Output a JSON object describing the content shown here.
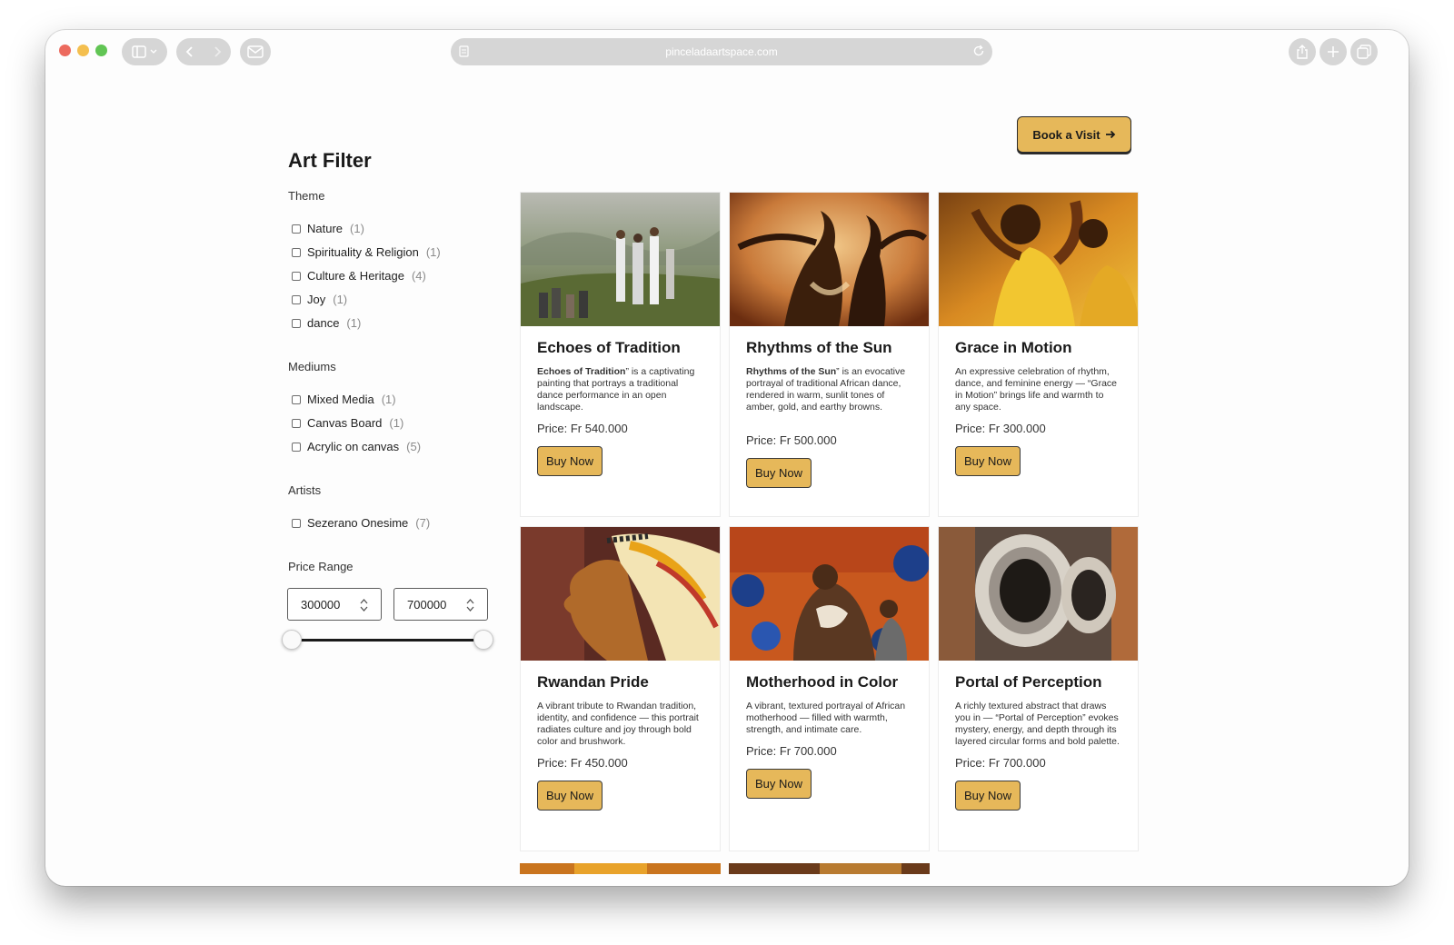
{
  "browser": {
    "url": "pinceladaartspace.com"
  },
  "header": {
    "book_label": "Book a Visit"
  },
  "filter": {
    "title": "Art Filter",
    "theme": {
      "label": "Theme",
      "items": [
        {
          "label": "Nature",
          "count": "(1)"
        },
        {
          "label": "Spirituality & Religion",
          "count": "(1)"
        },
        {
          "label": "Culture & Heritage",
          "count": "(4)"
        },
        {
          "label": "Joy",
          "count": "(1)"
        },
        {
          "label": "dance",
          "count": "(1)"
        }
      ]
    },
    "mediums": {
      "label": "Mediums",
      "items": [
        {
          "label": "Mixed Media",
          "count": "(1)"
        },
        {
          "label": "Canvas Board",
          "count": "(1)"
        },
        {
          "label": "Acrylic on canvas",
          "count": "(5)"
        }
      ]
    },
    "artists": {
      "label": "Artists",
      "items": [
        {
          "label": "Sezerano Onesime",
          "count": "(7)"
        }
      ]
    },
    "price": {
      "label": "Price Range",
      "min": "300000",
      "max": "700000"
    }
  },
  "artworks": [
    {
      "title": "Echoes of Tradition",
      "desc_bold": "Echoes of Tradition",
      "desc": "” is a captivating painting that portrays a traditional dance performance in an open landscape.",
      "price": "Price: Fr 540.000",
      "buy": "Buy Now"
    },
    {
      "title": "Rhythms of the Sun",
      "desc_bold": "Rhythms of the Sun",
      "desc": "” is an evocative portrayal of traditional African dance, rendered in warm, sunlit tones of amber, gold, and earthy browns.",
      "price": "Price: Fr 500.000",
      "buy": "Buy Now"
    },
    {
      "title": "Grace in Motion",
      "desc_bold": "",
      "desc": "An expressive celebration of rhythm, dance, and feminine energy — “Grace in Motion” brings life and warmth to any space.",
      "price": "Price: Fr 300.000",
      "buy": "Buy Now"
    },
    {
      "title": "Rwandan Pride",
      "desc_bold": "",
      "desc": "A vibrant tribute to Rwandan tradition, identity, and confidence — this portrait radiates culture and joy through bold color and brushwork.",
      "price": "Price: Fr 450.000",
      "buy": "Buy Now"
    },
    {
      "title": "Motherhood in Color",
      "desc_bold": "",
      "desc": "A vibrant, textured portrayal of African motherhood — filled with warmth, strength, and intimate care.",
      "price": "Price: Fr 700.000",
      "buy": "Buy Now"
    },
    {
      "title": "Portal of Perception",
      "desc_bold": "",
      "desc": "A richly textured abstract that draws you in — “Portal of Perception” evokes mystery, energy, and depth through its layered circular forms and bold palette.",
      "price": "Price: Fr 700.000",
      "buy": "Buy Now"
    }
  ],
  "theme_colors": {
    "accent": "#e6b85a",
    "text": "#1a1a1a"
  }
}
